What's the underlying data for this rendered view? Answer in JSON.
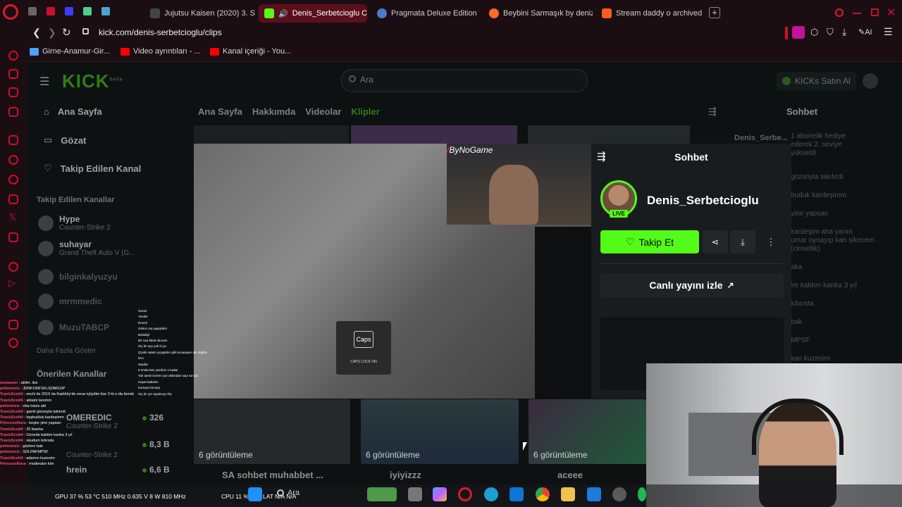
{
  "browser": {
    "tabs": [
      {
        "label": "Jujutsu Kaisen (2020) 3. S",
        "color": "#e8e8e8"
      },
      {
        "label": "Denis_Serbetcioglu Cl",
        "color": "#53fc18",
        "active": true
      },
      {
        "label": "Pragmata Deluxe Edition",
        "color": "#4a7bd1"
      },
      {
        "label": "Beybini Sarmaşık by deniz",
        "color": "#ff6a2b"
      },
      {
        "label": "Stream daddy o archived",
        "color": "#ff5a1f"
      }
    ],
    "url": "kick.com/denis-serbetcioglu/clips",
    "ai_label": "AI",
    "bookmarks": [
      {
        "label": "Girne-Anamur-Gir...",
        "color": "#4ea1ff"
      },
      {
        "label": "Video ayrıntıları - ...",
        "color": "#ff0000"
      },
      {
        "label": "Kanal içeriği - You...",
        "color": "#ff0000"
      }
    ]
  },
  "kick": {
    "logo": "KICK",
    "logo_sup": "beta",
    "search_placeholder": "Ara",
    "buy_kicks": "KICKs Satın Al",
    "nav": [
      {
        "label": "Ana Sayfa",
        "icon": "home-icon"
      },
      {
        "label": "Gözat",
        "icon": "browse-icon"
      },
      {
        "label": "Takip Edilen Kanal",
        "icon": "heart-icon"
      }
    ],
    "followed_header": "Takip Edilen Kanallar",
    "followed": [
      {
        "name": "Hype",
        "game": "Counter-Strike 2"
      },
      {
        "name": "suhayar",
        "game": "Grand Theft Auto V (G..."
      },
      {
        "name": "bilginkalyuzyu",
        "game": ""
      },
      {
        "name": "mrmmedic",
        "game": ""
      },
      {
        "name": "MuzuTABCP",
        "game": ""
      }
    ],
    "show_more": "Daha Fazla Göster",
    "recommended_header": "Önerilen Kanallar",
    "recommended": [
      {
        "name": "OMEREDIC",
        "game": "Counter-Strike 2",
        "count": "326"
      },
      {
        "name": "",
        "game": "Counter-Strike 2",
        "count": "8,3 B"
      },
      {
        "name": "hrein",
        "game": "",
        "count": "6,6 B"
      }
    ],
    "tabs": [
      "Ana Sayfa",
      "Hakkımda",
      "Videolar",
      "Klipler"
    ],
    "active_tab": "Klipler",
    "chat_title_bg": "Sohbet",
    "chat_bg_lines": [
      "1 abonelik hediye",
      "ederek 2. seviye",
      "yükseldi",
      "gözsoyla takılırdı",
      "buduk kardeşimm",
      "yine yapsan",
      "kardeşim aha yarım",
      "umar oynayıp kan sikecem",
      "(cinsellik)",
      "aka",
      "lre kaldım kanka 3 yıl",
      "kıbrısta",
      "bak",
      "MPSF",
      "kan kuzenim"
    ],
    "bg_chat_user": "Denis_Serbe..."
  },
  "clip_modal": {
    "streamer_overlay": "ByNoGame",
    "chat_header": "Sohbet",
    "channel_name": "Denis_Serbetcioglu",
    "live_badge": "LIVE",
    "follow_label": "Takip Et",
    "watch_live": "Canlı yayını izle",
    "caps_key": "Caps",
    "caps_status": "CAPS LOCK ON"
  },
  "thumbnails": [
    {
      "views": "6 görüntüleme",
      "title": "SA sohbet muhabbet ..."
    },
    {
      "views": "6 görüntüleme",
      "title": "iyiyizzz"
    },
    {
      "views": "6 görüntüleme",
      "title": "aceee"
    }
  ],
  "overlay_chat": [
    {
      "user": "esmaeem",
      "text": "aklim. iksi"
    },
    {
      "user": "pelimmiziz",
      "text": "JDNFONFSFLSDMGOP"
    },
    {
      "user": "TravisScott4",
      "text": "onchi ile 2016 da Kadıköy'de esrar içtiydim lise 3 tü o da bende"
    },
    {
      "user": "TravisScott4",
      "text": "ablaini tanımm"
    },
    {
      "user": "pelimmiziz",
      "text": "oha travis abi"
    },
    {
      "user": "TravisScott4",
      "text": "gamil gözsoyla takılırdı"
    },
    {
      "user": "TravisScott4",
      "text": "hpşbulduk kardeşimm"
    },
    {
      "user": "PrincessAlara",
      "text": "keşke yine yapsan"
    },
    {
      "user": "TravisScott4",
      "text": "25 tkanka"
    },
    {
      "user": "TravisScott4",
      "text": "Girnede kaldım kanka 3 yıl"
    },
    {
      "user": "TravisScott4",
      "text": "okudum kıbrısta"
    },
    {
      "user": "pelimmiziz",
      "text": "gözlere bak"
    },
    {
      "user": "pelimmiziz",
      "text": "SDLPAFMPSF"
    },
    {
      "user": "TravisScott4",
      "text": "adamın kuzenim"
    },
    {
      "user": "PrincessAlara",
      "text": "moderator kim"
    }
  ],
  "mini_chat": [
    "Genel",
    "Yeniler",
    "Ermeli",
    "Gökce ma yapıştıktır",
    "Bohabyl",
    "Bir naa fakat okuram",
    "Hiç bir şey yok ki ya",
    "Çiçeki satam çiçegmler gibi kocaayam aki dağılıe",
    "Evo",
    "Sayılar",
    "8 nmita ben yazıkım o kadar",
    "Yok tamini torren yaz aklımdan sayı tut yaz",
    "Hayat bakalım",
    "Konuşa konuşa",
    "Hiç bir yer ayakmıyo hiç"
  ],
  "hud": {
    "gpu": "GPU 37 % 53 °C 510 MHz 0.635 V 8 W 810 MHz",
    "cpu": "CPU 11 %",
    "lat": "LAT N/A N/A"
  },
  "taskbar": {
    "search": "Ara"
  }
}
